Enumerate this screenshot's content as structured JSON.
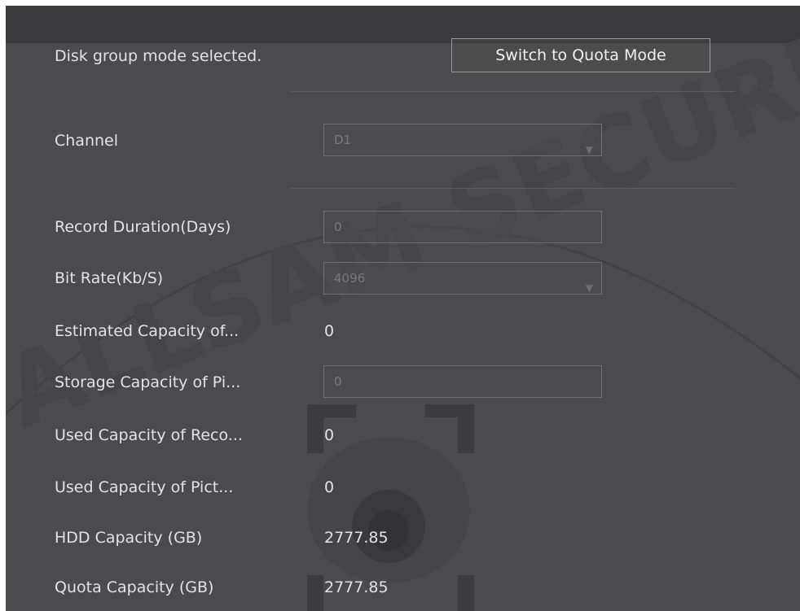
{
  "mode": {
    "status_text": "Disk group mode selected.",
    "switch_label": "Switch to Quota Mode"
  },
  "form": {
    "channel_label": "Channel",
    "channel_value": "D1",
    "record_duration_label": "Record Duration(Days)",
    "record_duration_value": "0",
    "bit_rate_label": "Bit Rate(Kb/S)",
    "bit_rate_value": "4096",
    "estimated_capacity_label": "Estimated Capacity of...",
    "estimated_capacity_value": "0",
    "storage_capacity_label": "Storage Capacity of Pi...",
    "storage_capacity_value": "0",
    "used_capacity_record_label": "Used Capacity of Reco...",
    "used_capacity_record_value": "0",
    "used_capacity_picture_label": "Used Capacity of Pict...",
    "used_capacity_picture_value": "0",
    "hdd_capacity_label": "HDD Capacity (GB)",
    "hdd_capacity_value": "2777.85",
    "quota_capacity_label": "Quota Capacity (GB)",
    "quota_capacity_value": "2777.85"
  },
  "watermark": {
    "text": "ALLSAM SECURITY"
  },
  "icons": {
    "dropdown": "chevron-down-icon"
  },
  "colors": {
    "panel_background": "#4b4b4d",
    "header_background": "#3a3a3c",
    "text": "#e3e3e3",
    "field_border": "#707072"
  }
}
